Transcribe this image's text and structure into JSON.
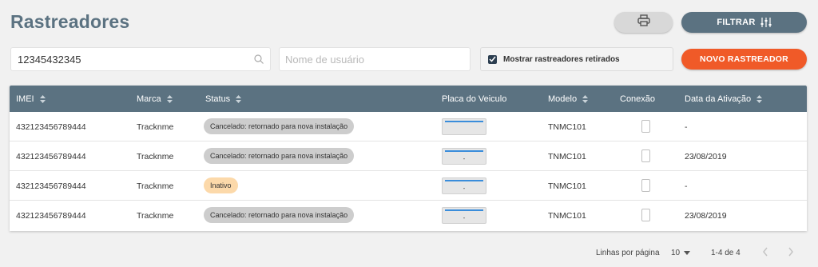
{
  "page": {
    "title": "Rastreadores"
  },
  "toolbar": {
    "print_icon": "printer-icon",
    "filter_label": "FILTRAR",
    "filter_icon": "sliders-icon",
    "new_label": "NOVO RASTREADOR"
  },
  "filters": {
    "search_value": "12345432345",
    "search_icon": "search-icon",
    "user_placeholder": "Nome de usuário",
    "retired_label": "Mostrar rastreadores retirados",
    "retired_checked": true
  },
  "table": {
    "headers": {
      "imei": "IMEI",
      "marca": "Marca",
      "status": "Status",
      "placa": "Placa do Veiculo",
      "modelo": "Modelo",
      "conexao": "Conexão",
      "data": "Data da Ativação"
    },
    "rows": [
      {
        "imei": "432123456789444",
        "marca": "Tracknme",
        "status": "Cancelado: retornado para nova instalação",
        "status_color": "#cdcdcd",
        "placa": "",
        "modelo": "TNMC101",
        "data": "-"
      },
      {
        "imei": "432123456789444",
        "marca": "Tracknme",
        "status": "Cancelado: retornado para nova instalação",
        "status_color": "#cdcdcd",
        "placa": "-",
        "modelo": "TNMC101",
        "data": "23/08/2019"
      },
      {
        "imei": "432123456789444",
        "marca": "Tracknme",
        "status": "Inativo",
        "status_color": "#fcd9aa",
        "placa": "-",
        "modelo": "TNMC101",
        "data": "-"
      },
      {
        "imei": "432123456789444",
        "marca": "Tracknme",
        "status": "Cancelado: retornado para nova instalação",
        "status_color": "#cdcdcd",
        "placa": "-",
        "modelo": "TNMC101",
        "data": "23/08/2019"
      }
    ]
  },
  "pagination": {
    "rows_label": "Linhas por página",
    "rows_value": "10",
    "range": "1-4 de 4",
    "prev_icon": "chevron-left-icon",
    "next_icon": "chevron-right-icon"
  },
  "colors": {
    "primary": "#5b7281",
    "accent": "#f05a28",
    "plate_stripe": "#3a8ddb"
  }
}
